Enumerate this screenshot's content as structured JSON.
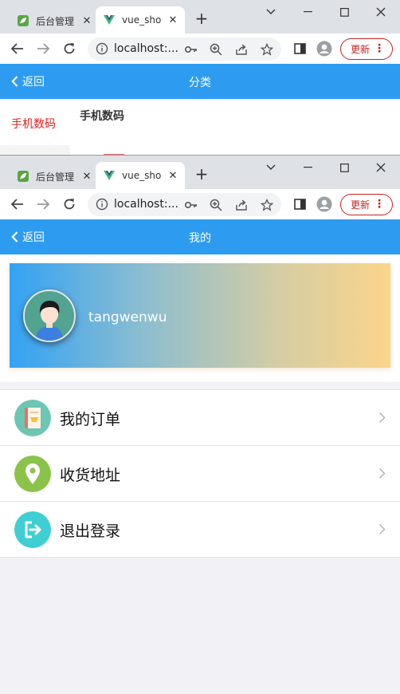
{
  "browser_top": {
    "tabs": [
      {
        "title": "后台管理"
      },
      {
        "title": "vue_shop"
      }
    ],
    "url": "localhost:...",
    "update_label": "更新"
  },
  "page_top": {
    "back_label": "返回",
    "title": "分类",
    "sidebar_selected": "手机数码",
    "section_title": "手机数码"
  },
  "browser_bottom": {
    "tabs": [
      {
        "title": "后台管理"
      },
      {
        "title": "vue_shop"
      }
    ],
    "url": "localhost:...",
    "update_label": "更新"
  },
  "page_bottom": {
    "back_label": "返回",
    "title": "我的",
    "username": "tangwenwu",
    "menu": [
      {
        "label": "我的订单",
        "icon": "order-book-icon",
        "color": "#6cc6b3"
      },
      {
        "label": "收货地址",
        "icon": "location-pin-icon",
        "color": "#8bc34a"
      },
      {
        "label": "退出登录",
        "icon": "logout-icon",
        "color": "#3fcfd3"
      }
    ]
  },
  "colors": {
    "app_bar": "#2d9cf0",
    "selected_category": "#e02020",
    "update_button": "#c5221f"
  }
}
